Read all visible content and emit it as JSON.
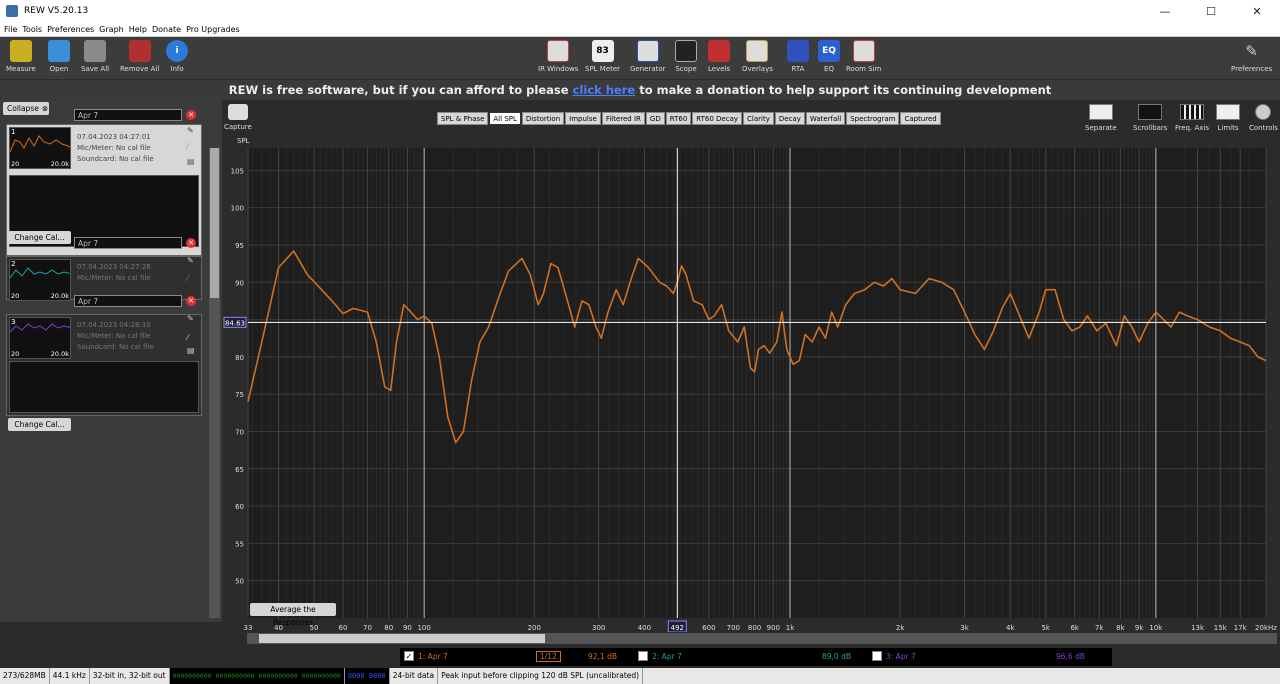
{
  "window": {
    "title": "REW V5.20.13",
    "minimize": "—",
    "maximize": "☐",
    "close": "✕"
  },
  "menu": [
    "File",
    "Tools",
    "Preferences",
    "Graph",
    "Help",
    "Donate",
    "Pro Upgrades"
  ],
  "toolbar_left": [
    {
      "label": "Measure",
      "icon": "measure-icon",
      "color": "#c8b020"
    },
    {
      "label": "Open",
      "icon": "folder-icon",
      "color": "#3b8ed8"
    },
    {
      "label": "Save All",
      "icon": "save-icon",
      "color": "#8a8a8a"
    },
    {
      "label": "Remove All",
      "icon": "remove-icon",
      "color": "#b03030"
    },
    {
      "label": "Info",
      "icon": "info-icon",
      "color": "#2a7ad8"
    }
  ],
  "toolbar_center": [
    {
      "label": "IR Windows",
      "icon": "ir-windows-icon",
      "color": "#c04040"
    },
    {
      "label": "SPL Meter",
      "icon": "spl-meter-icon",
      "color": "#eeeeee",
      "text": "83"
    },
    {
      "label": "Generator",
      "icon": "generator-icon",
      "color": "#3050c0"
    },
    {
      "label": "Scope",
      "icon": "scope-icon",
      "color": "#222222"
    },
    {
      "label": "Levels",
      "icon": "levels-icon",
      "color": "#c03030"
    },
    {
      "label": "Overlays",
      "icon": "overlays-icon",
      "color": "#c0a040"
    },
    {
      "label": "RTA",
      "icon": "rta-icon",
      "color": "#3050c0"
    },
    {
      "label": "EQ",
      "icon": "eq-icon",
      "color": "#2a60d0",
      "text": "EQ"
    },
    {
      "label": "Room Sim",
      "icon": "room-sim-icon",
      "color": "#c04040"
    }
  ],
  "toolbar_right": {
    "label": "Preferences",
    "icon": "preferences-icon"
  },
  "banner": {
    "before": "REW is free software, but if you can afford to please",
    "link": "click here",
    "after": "to make a donation to help support its continuing development"
  },
  "left_panel": {
    "collapse": "Collapse",
    "change_cal": "Change Cal...",
    "measurements": [
      {
        "num": "1",
        "name": "Apr 7",
        "date": "07.04.2023 04:27:01",
        "mic": "Mic/Meter: No cal file",
        "soundcard": "Soundcard: No cal file",
        "lo": "20",
        "hi": "20.0k",
        "color": "#d07020"
      },
      {
        "num": "2",
        "name": "Apr 7",
        "date": "07.04.2023 04:27:26",
        "mic": "Mic/Meter: No cal file",
        "soundcard": "Soundcard: No cal file",
        "lo": "20",
        "hi": "20.0k",
        "color": "#20a0a0"
      },
      {
        "num": "3",
        "name": "Apr 7",
        "date": "07.04.2023 04:28:10",
        "mic": "Mic/Meter: No cal file",
        "soundcard": "Soundcard: No cal file",
        "lo": "20",
        "hi": "20.0k",
        "color": "#8040d0"
      }
    ]
  },
  "graph": {
    "capture": "Capture",
    "tabs": [
      "SPL & Phase",
      "All SPL",
      "Distortion",
      "Impulse",
      "Filtered IR",
      "GD",
      "RT60",
      "RT60 Decay",
      "Clarity",
      "Decay",
      "Waterfall",
      "Spectrogram",
      "Captured"
    ],
    "active_tab": "All SPL",
    "right_buttons": [
      "Separate",
      "Scrollbars",
      "Freq. Axis",
      "Limits",
      "Controls"
    ],
    "avg_button": "Average the Responses",
    "cursor_y_label": "84.63",
    "cursor_x_label": "492"
  },
  "chart_data": {
    "type": "line",
    "ylabel": "SPL",
    "xscale": "log",
    "xlim": [
      33,
      20000
    ],
    "ylim": [
      45,
      108
    ],
    "yticks": [
      50,
      55,
      60,
      65,
      70,
      75,
      80,
      85,
      90,
      95,
      100,
      105
    ],
    "xticks": [
      {
        "v": 33,
        "t": "33"
      },
      {
        "v": 40,
        "t": "40"
      },
      {
        "v": 50,
        "t": "50"
      },
      {
        "v": 60,
        "t": "60"
      },
      {
        "v": 70,
        "t": "70"
      },
      {
        "v": 80,
        "t": "80"
      },
      {
        "v": 90,
        "t": "90"
      },
      {
        "v": 100,
        "t": "100"
      },
      {
        "v": 200,
        "t": "200"
      },
      {
        "v": 300,
        "t": "300"
      },
      {
        "v": 400,
        "t": "400"
      },
      {
        "v": 600,
        "t": "600"
      },
      {
        "v": 700,
        "t": "700"
      },
      {
        "v": 800,
        "t": "800"
      },
      {
        "v": 900,
        "t": "900"
      },
      {
        "v": 1000,
        "t": "1k"
      },
      {
        "v": 2000,
        "t": "2k"
      },
      {
        "v": 3000,
        "t": "3k"
      },
      {
        "v": 4000,
        "t": "4k"
      },
      {
        "v": 5000,
        "t": "5k"
      },
      {
        "v": 6000,
        "t": "6k"
      },
      {
        "v": 7000,
        "t": "7k"
      },
      {
        "v": 8000,
        "t": "8k"
      },
      {
        "v": 9000,
        "t": "9k"
      },
      {
        "v": 10000,
        "t": "10k"
      },
      {
        "v": 13000,
        "t": "13k"
      },
      {
        "v": 15000,
        "t": "15k"
      },
      {
        "v": 17000,
        "t": "17k"
      },
      {
        "v": 20000,
        "t": "20kHz"
      }
    ],
    "cursor": {
      "x": 492,
      "y": 84.63
    },
    "series": [
      {
        "name": "1: Apr 7",
        "color": "#d07020",
        "points": [
          [
            33,
            74
          ],
          [
            36,
            82
          ],
          [
            40,
            92
          ],
          [
            44,
            94.2
          ],
          [
            48,
            91
          ],
          [
            52,
            89.2
          ],
          [
            56,
            87.5
          ],
          [
            60,
            85.8
          ],
          [
            64,
            86.5
          ],
          [
            70,
            86
          ],
          [
            74,
            82
          ],
          [
            78,
            76
          ],
          [
            81,
            75.5
          ],
          [
            84,
            82
          ],
          [
            88,
            87
          ],
          [
            92,
            86
          ],
          [
            96,
            85
          ],
          [
            100,
            85.5
          ],
          [
            105,
            84.5
          ],
          [
            110,
            80
          ],
          [
            116,
            72
          ],
          [
            122,
            68.5
          ],
          [
            128,
            70
          ],
          [
            135,
            77
          ],
          [
            142,
            82
          ],
          [
            150,
            84
          ],
          [
            160,
            88
          ],
          [
            170,
            91.5
          ],
          [
            185,
            93.2
          ],
          [
            195,
            91
          ],
          [
            205,
            87
          ],
          [
            212,
            88.5
          ],
          [
            222,
            92.5
          ],
          [
            232,
            92
          ],
          [
            245,
            88
          ],
          [
            258,
            84
          ],
          [
            270,
            87.5
          ],
          [
            282,
            87
          ],
          [
            295,
            84
          ],
          [
            305,
            82.5
          ],
          [
            318,
            86
          ],
          [
            335,
            89
          ],
          [
            350,
            87
          ],
          [
            368,
            90.5
          ],
          [
            385,
            93.2
          ],
          [
            410,
            92
          ],
          [
            440,
            90
          ],
          [
            460,
            89.5
          ],
          [
            480,
            88.5
          ],
          [
            492,
            90
          ],
          [
            505,
            92.2
          ],
          [
            520,
            91
          ],
          [
            545,
            87.5
          ],
          [
            575,
            87
          ],
          [
            600,
            85
          ],
          [
            620,
            85.5
          ],
          [
            650,
            87
          ],
          [
            680,
            83.5
          ],
          [
            720,
            82
          ],
          [
            750,
            84
          ],
          [
            780,
            78.5
          ],
          [
            800,
            78
          ],
          [
            820,
            81
          ],
          [
            850,
            81.5
          ],
          [
            880,
            80.5
          ],
          [
            920,
            82
          ],
          [
            950,
            86
          ],
          [
            980,
            81
          ],
          [
            1020,
            79
          ],
          [
            1060,
            79.5
          ],
          [
            1100,
            83
          ],
          [
            1150,
            82
          ],
          [
            1200,
            84
          ],
          [
            1250,
            82.5
          ],
          [
            1300,
            86
          ],
          [
            1350,
            84
          ],
          [
            1420,
            87
          ],
          [
            1500,
            88.5
          ],
          [
            1600,
            89
          ],
          [
            1700,
            90
          ],
          [
            1800,
            89.5
          ],
          [
            1900,
            90.5
          ],
          [
            2000,
            89
          ],
          [
            2200,
            88.5
          ],
          [
            2400,
            90.5
          ],
          [
            2600,
            90
          ],
          [
            2800,
            89
          ],
          [
            3000,
            86
          ],
          [
            3200,
            83
          ],
          [
            3400,
            81
          ],
          [
            3600,
            83.5
          ],
          [
            3800,
            86.5
          ],
          [
            4000,
            88.5
          ],
          [
            4200,
            86
          ],
          [
            4500,
            82.5
          ],
          [
            4800,
            86
          ],
          [
            5000,
            89
          ],
          [
            5300,
            89
          ],
          [
            5600,
            85
          ],
          [
            5900,
            83.5
          ],
          [
            6200,
            84
          ],
          [
            6500,
            85.5
          ],
          [
            6900,
            83.5
          ],
          [
            7300,
            84.5
          ],
          [
            7800,
            81.5
          ],
          [
            8200,
            85.5
          ],
          [
            8600,
            84
          ],
          [
            9000,
            82
          ],
          [
            9500,
            84.5
          ],
          [
            10000,
            86
          ],
          [
            10500,
            85
          ],
          [
            11000,
            84
          ],
          [
            11600,
            86
          ],
          [
            12200,
            85.5
          ],
          [
            13000,
            85
          ],
          [
            14000,
            84
          ],
          [
            15000,
            83.5
          ],
          [
            16000,
            82.5
          ],
          [
            17000,
            82
          ],
          [
            18000,
            81.5
          ],
          [
            19000,
            80
          ],
          [
            20000,
            79.5
          ]
        ]
      }
    ]
  },
  "legend": [
    {
      "label": "1: Apr 7",
      "value": "92,1 dB",
      "color": "#d07020",
      "checked": true
    },
    {
      "label": "2: Apr 7",
      "value": "89,0 dB",
      "color": "#20a0a0",
      "checked": false
    },
    {
      "label": "3: Apr 7",
      "value": "96,6 dB",
      "color": "#8040d0",
      "checked": false
    }
  ],
  "smoothing": "1/12",
  "status": {
    "memory": "273/628MB",
    "rate": "44.1 kHz",
    "bits": "32-bit in, 32-bit out",
    "meter": "0000000000 0000000000 0000000000 0000000000",
    "meter2": "0000 0000",
    "data": "24-bit data",
    "peak": "Peak input before clipping 120 dB SPL (uncalibrated)"
  }
}
